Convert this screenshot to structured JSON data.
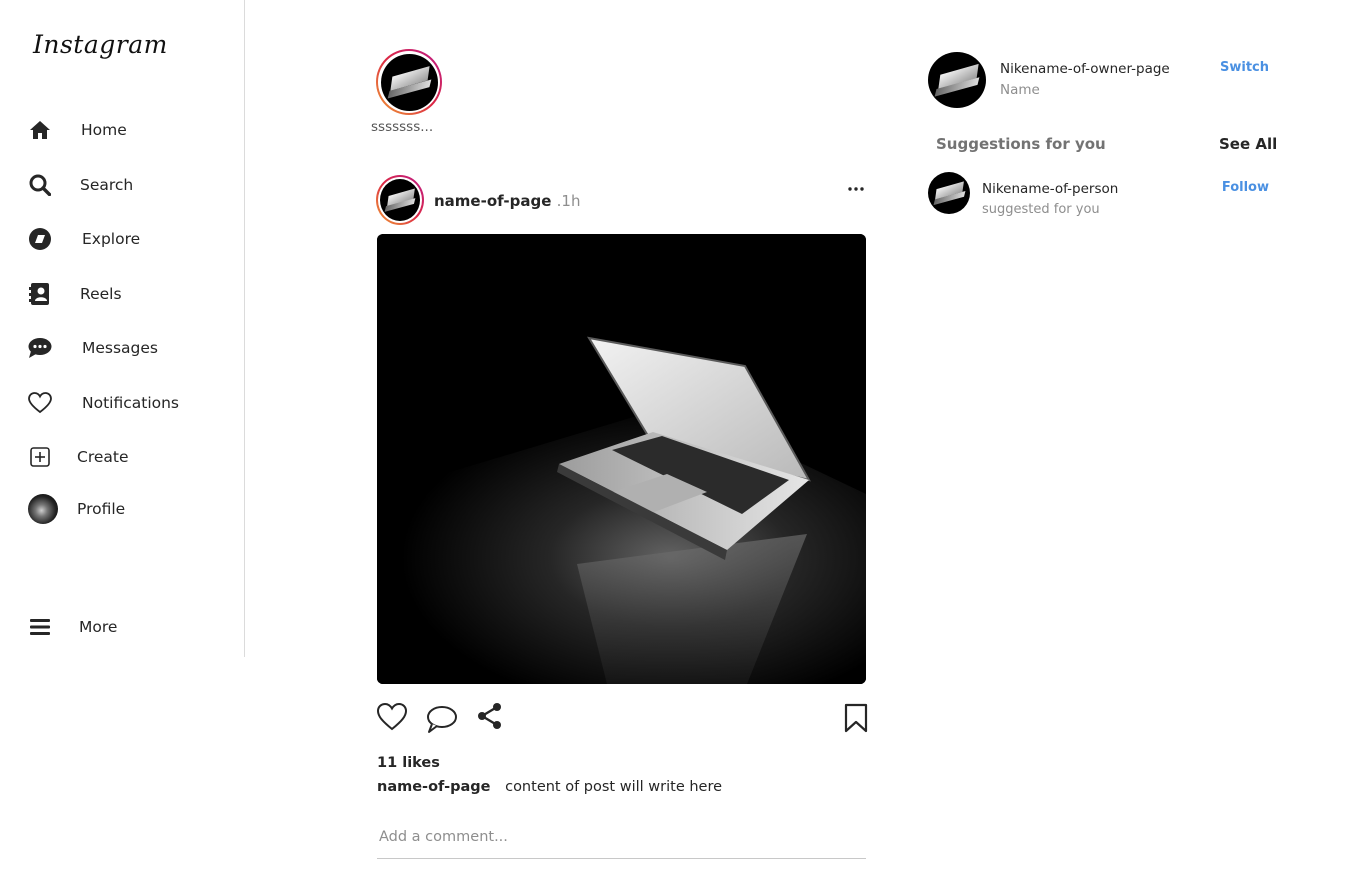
{
  "app": {
    "logo": "Instagram"
  },
  "sidebar": {
    "items": [
      {
        "label": "Home",
        "icon": "home-icon"
      },
      {
        "label": "Search",
        "icon": "search-icon"
      },
      {
        "label": "Explore",
        "icon": "compass-icon"
      },
      {
        "label": "Reels",
        "icon": "reels-icon"
      },
      {
        "label": "Messages",
        "icon": "message-icon"
      },
      {
        "label": "Notifications",
        "icon": "heart-icon"
      },
      {
        "label": "Create",
        "icon": "plus-square-icon"
      },
      {
        "label": "Profile",
        "icon": "profile-avatar"
      },
      {
        "label": "More",
        "icon": "menu-icon"
      }
    ]
  },
  "stories": [
    {
      "name": "sssssss..."
    }
  ],
  "post": {
    "author": "name-of-page",
    "time": ".1h",
    "likes": "11 likes",
    "caption_author": "name-of-page",
    "caption_text": "content of post will write here",
    "comment_placeholder": "Add a comment..."
  },
  "account": {
    "nickname": "Nikename-of-owner-page",
    "name": "Name",
    "switch_label": "Switch"
  },
  "suggestions": {
    "title": "Suggestions for you",
    "see_all_label": "See All",
    "items": [
      {
        "nickname": "Nikename-of-person",
        "subtitle": "suggested for you",
        "action": "Follow"
      }
    ]
  },
  "colors": {
    "link": "#4a90e2",
    "text": "#262626",
    "muted": "#8e8e8e",
    "border": "#dbdbdb"
  }
}
